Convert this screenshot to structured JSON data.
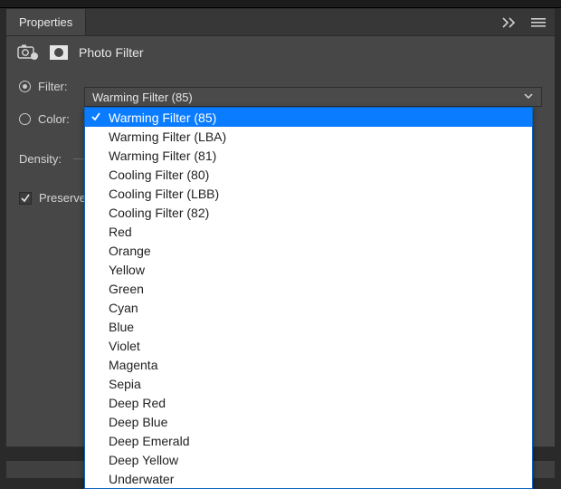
{
  "header": {
    "tab_label": "Properties"
  },
  "section": {
    "title": "Photo Filter"
  },
  "controls": {
    "filter_label": "Filter:",
    "color_label": "Color:",
    "density_label": "Density:",
    "preserve_label": "Preserve"
  },
  "dropdown": {
    "selected": "Warming Filter (85)",
    "items": [
      "Warming Filter (85)",
      "Warming Filter (LBA)",
      "Warming Filter (81)",
      "Cooling Filter (80)",
      "Cooling Filter (LBB)",
      "Cooling Filter (82)",
      "Red",
      "Orange",
      "Yellow",
      "Green",
      "Cyan",
      "Blue",
      "Violet",
      "Magenta",
      "Sepia",
      "Deep Red",
      "Deep Blue",
      "Deep Emerald",
      "Deep Yellow",
      "Underwater"
    ]
  }
}
